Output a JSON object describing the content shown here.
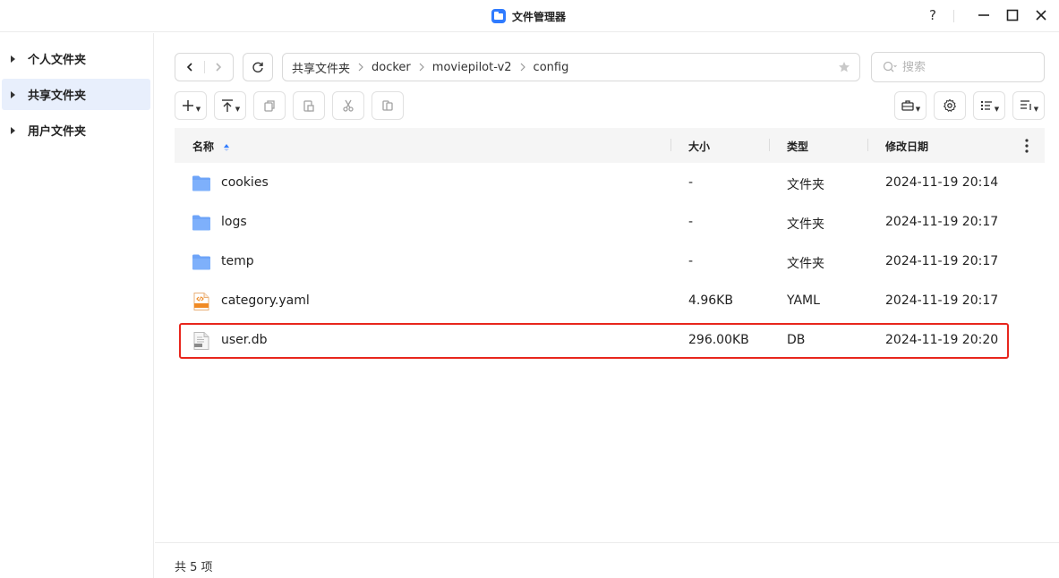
{
  "window": {
    "title": "文件管理器",
    "help_label": "?"
  },
  "sidebar": {
    "items": [
      {
        "label": "个人文件夹",
        "active": false
      },
      {
        "label": "共享文件夹",
        "active": true
      },
      {
        "label": "用户文件夹",
        "active": false
      }
    ]
  },
  "path": {
    "crumbs": [
      "共享文件夹",
      "docker",
      "moviepilot-v2",
      "config"
    ]
  },
  "search": {
    "placeholder": "搜索"
  },
  "table": {
    "headers": {
      "name": "名称",
      "size": "大小",
      "type": "类型",
      "modified": "修改日期"
    },
    "rows": [
      {
        "name": "cookies",
        "size": "-",
        "type": "文件夹",
        "modified": "2024-11-19 20:14",
        "icon": "folder-icon"
      },
      {
        "name": "logs",
        "size": "-",
        "type": "文件夹",
        "modified": "2024-11-19 20:17",
        "icon": "folder-icon"
      },
      {
        "name": "temp",
        "size": "-",
        "type": "文件夹",
        "modified": "2024-11-19 20:17",
        "icon": "folder-icon"
      },
      {
        "name": "category.yaml",
        "size": "4.96KB",
        "type": "YAML",
        "modified": "2024-11-19 20:17",
        "icon": "yaml-file-icon"
      },
      {
        "name": "user.db",
        "size": "296.00KB",
        "type": "DB",
        "modified": "2024-11-19 20:20",
        "icon": "db-file-icon"
      }
    ]
  },
  "footer": {
    "count_text": "共 5 项"
  },
  "colors": {
    "accent": "#2f7bff",
    "folder": "#6ea4f8",
    "highlight": "#e8261d",
    "active_bg": "#e8effc"
  }
}
